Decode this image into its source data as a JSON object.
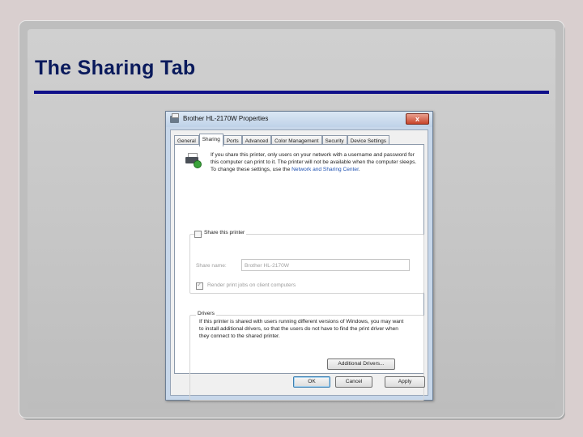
{
  "slide": {
    "title": "The Sharing Tab"
  },
  "dialog": {
    "title": "Brother HL-2170W Properties",
    "close_glyph": "x",
    "tabs": [
      {
        "label": "General",
        "active": false
      },
      {
        "label": "Sharing",
        "active": true
      },
      {
        "label": "Ports",
        "active": false
      },
      {
        "label": "Advanced",
        "active": false
      },
      {
        "label": "Color Management",
        "active": false
      },
      {
        "label": "Security",
        "active": false
      },
      {
        "label": "Device Settings",
        "active": false
      }
    ],
    "info_text": "If you share this printer, only users on your network with a username and password for this computer can print to it. The printer will not be available when the computer sleeps. To change these settings, use the ",
    "info_link": "Network and Sharing Center",
    "info_end": ".",
    "share_checkbox_label": "Share this printer",
    "share_name_label": "Share name:",
    "share_name_value": "Brother HL-2170W",
    "render_label": "Render print jobs on client computers",
    "drivers_legend": "Drivers",
    "drivers_text": "If this printer is shared with users running different versions of Windows, you may want to install additional drivers, so that the users do not have to find the print driver when they connect to the shared printer.",
    "additional_drivers_button": "Additional Drivers...",
    "ok_button": "OK",
    "cancel_button": "Cancel",
    "apply_button": "Apply"
  },
  "colors": {
    "title_text": "#0a1a5c",
    "title_rule": "#10108a",
    "link": "#1c4fb0"
  },
  "icons": [
    "printer-icon",
    "close-icon",
    "checkbox-icon"
  ]
}
